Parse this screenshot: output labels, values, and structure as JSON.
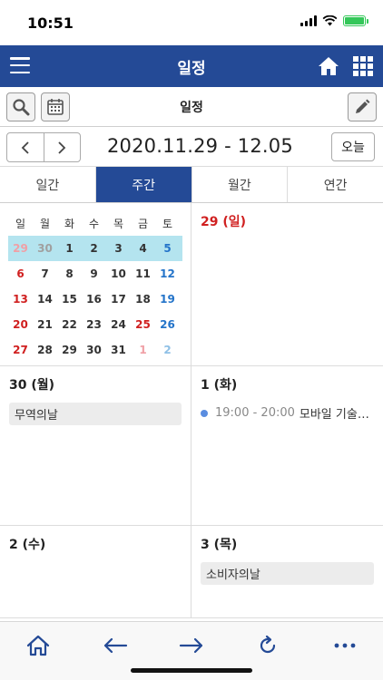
{
  "status_bar": {
    "time": "10:51"
  },
  "header": {
    "title": "일정"
  },
  "toolbar": {
    "title": "일정"
  },
  "range": {
    "label": "2020.11.29 - 12.05",
    "today_label": "오늘"
  },
  "tabs": [
    {
      "label": "일간",
      "active": false
    },
    {
      "label": "주간",
      "active": true
    },
    {
      "label": "월간",
      "active": false
    },
    {
      "label": "연간",
      "active": false
    }
  ],
  "mini_calendar": {
    "weekdays": [
      "일",
      "월",
      "화",
      "수",
      "목",
      "금",
      "토"
    ],
    "weeks": [
      [
        "29",
        "30",
        "1",
        "2",
        "3",
        "4",
        "5"
      ],
      [
        "6",
        "7",
        "8",
        "9",
        "10",
        "11",
        "12"
      ],
      [
        "13",
        "14",
        "15",
        "16",
        "17",
        "18",
        "19"
      ],
      [
        "20",
        "21",
        "22",
        "23",
        "24",
        "25",
        "26"
      ],
      [
        "27",
        "28",
        "29",
        "30",
        "31",
        "1",
        "2"
      ]
    ],
    "highlighted_week": 0
  },
  "days": [
    {
      "label": "29 (일)"
    },
    {
      "label": "30 (월)",
      "tag": "무역의날"
    },
    {
      "label": "1 (화)",
      "event": {
        "time": "19:00 - 20:00",
        "title": "모바일 기술…"
      }
    },
    {
      "label": "2 (수)"
    },
    {
      "label": "3 (목)",
      "tag": "소비자의날"
    }
  ],
  "colors": {
    "brand": "#244a96",
    "sunday": "#d02020",
    "saturday": "#2474c9",
    "highlight": "#b4e4ef"
  }
}
